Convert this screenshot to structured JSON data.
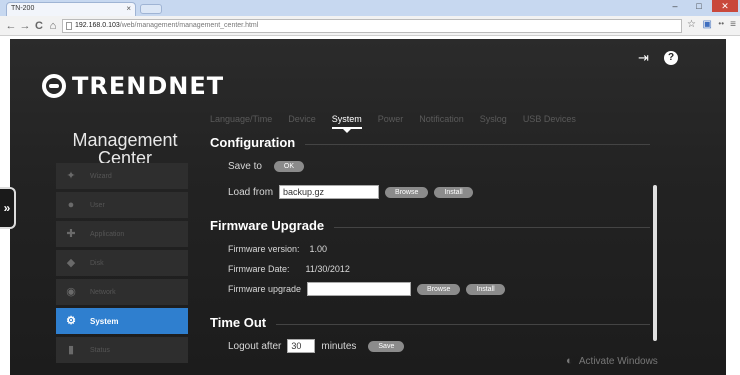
{
  "browser": {
    "tab_title": "TN-200",
    "tab_close": "×",
    "url_host": "192.168.0.103",
    "url_path": "/web/management/management_center.html",
    "win_min": "–",
    "win_max": "□",
    "win_close": "✕"
  },
  "brand": {
    "logo_text": "TRENDNET"
  },
  "sidebar": {
    "title_line1": "Management",
    "title_line2": "Center",
    "items": [
      {
        "label": "Wizard",
        "icon": "wand-icon"
      },
      {
        "label": "User",
        "icon": "user-icon"
      },
      {
        "label": "Application",
        "icon": "puzzle-icon"
      },
      {
        "label": "Disk",
        "icon": "disk-icon"
      },
      {
        "label": "Network",
        "icon": "network-icon"
      },
      {
        "label": "System",
        "icon": "system-icon",
        "active": true
      },
      {
        "label": "Status",
        "icon": "status-icon"
      }
    ]
  },
  "tabs": [
    "Language/Time",
    "Device",
    "System",
    "Power",
    "Notification",
    "Syslog",
    "USB Devices"
  ],
  "configuration": {
    "heading": "Configuration",
    "save_label": "Save to",
    "ok_button": "OK",
    "load_label": "Load from",
    "load_value": "backup.gz",
    "browse_button": "Browse",
    "install_button": "Install"
  },
  "firmware": {
    "heading": "Firmware Upgrade",
    "version_label": "Firmware version:",
    "version_value": "1.00",
    "date_label": "Firmware Date:",
    "date_value": "11/30/2012",
    "upgrade_label": "Firmware upgrade",
    "browse_button": "Browse",
    "install_button": "Install"
  },
  "timeout": {
    "heading": "Time Out",
    "logout_label": "Logout after",
    "logout_value": "30",
    "minutes_label": "minutes",
    "save_button": "Save"
  },
  "watermark": "Activate Windows"
}
